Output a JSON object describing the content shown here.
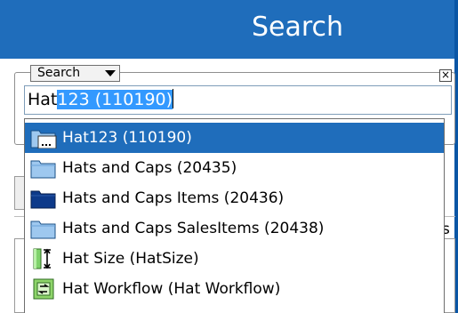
{
  "header": {
    "title": "Search"
  },
  "search_panel": {
    "mode_select": {
      "selected": "Search"
    },
    "close_label": "×",
    "input": {
      "typed": "Hat",
      "selected_text": "123 (110190)"
    }
  },
  "behind": {
    "partial_letter": "s"
  },
  "dropdown": {
    "items": [
      {
        "label": "Hat123 (110190)",
        "icon": "page-folder-icon",
        "selected": true
      },
      {
        "label": "Hats and Caps (20435)",
        "icon": "folder-light-icon",
        "selected": false
      },
      {
        "label": "Hats and Caps Items (20436)",
        "icon": "folder-dark-icon",
        "selected": false
      },
      {
        "label": "Hats and Caps SalesItems (20438)",
        "icon": "folder-light-icon",
        "selected": false
      },
      {
        "label": "Hat Size (HatSize)",
        "icon": "attribute-size-icon",
        "selected": false
      },
      {
        "label": "Hat Workflow (Hat Workflow)",
        "icon": "workflow-icon",
        "selected": false
      }
    ]
  },
  "colors": {
    "header_bg": "#1f6dbb",
    "selection_bg": "#1f6dbb",
    "text_selection_bg": "#3399ff",
    "folder_light": "#9ec8ef",
    "folder_dark": "#0d3a8a"
  }
}
